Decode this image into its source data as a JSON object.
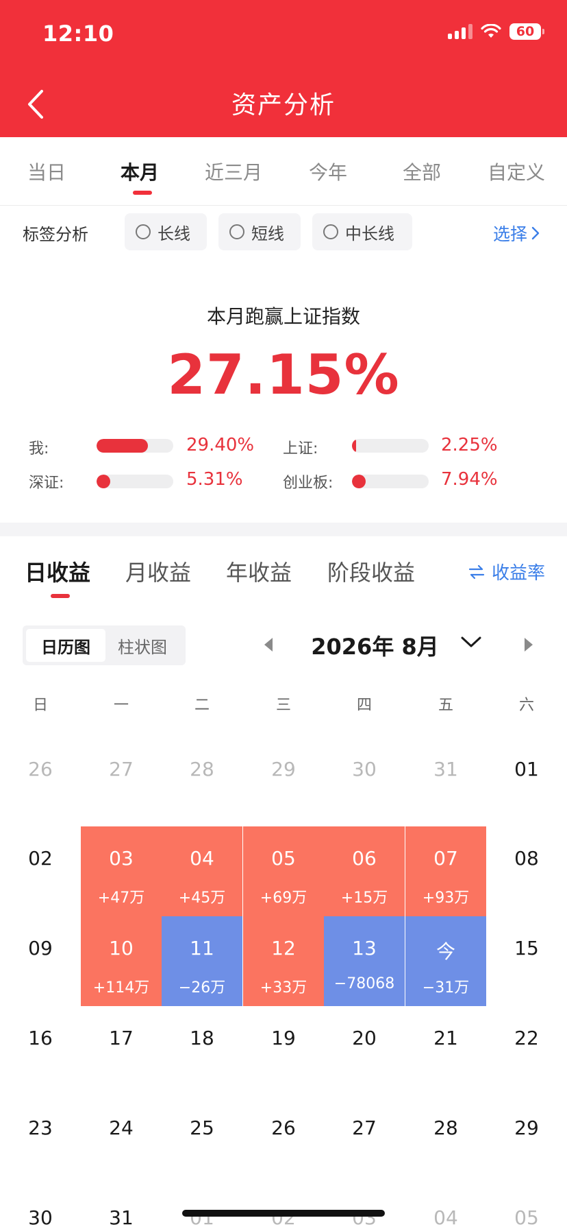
{
  "status_bar": {
    "time": "12:10",
    "battery": "60"
  },
  "header": {
    "title": "资产分析"
  },
  "period_tabs": [
    {
      "label": "当日"
    },
    {
      "label": "本月",
      "active": true
    },
    {
      "label": "近三月"
    },
    {
      "label": "今年"
    },
    {
      "label": "全部"
    },
    {
      "label": "自定义"
    }
  ],
  "tag_analysis": {
    "title": "标签分析",
    "options": [
      "长线",
      "短线",
      "中长线"
    ],
    "select_label": "选择"
  },
  "summary": {
    "title": "本月跑赢上证指数",
    "value": "27.15%",
    "comparisons": [
      {
        "label": "我:",
        "value": "29.40%",
        "level": 0.67
      },
      {
        "label": "上证:",
        "value": "2.25%",
        "level": 0.05
      },
      {
        "label": "深证:",
        "value": "5.31%",
        "level": 0.12
      },
      {
        "label": "创业板:",
        "value": "7.94%",
        "level": 0.18
      }
    ]
  },
  "income_tabs": [
    {
      "label": "日收益",
      "active": true
    },
    {
      "label": "月收益"
    },
    {
      "label": "年收益"
    },
    {
      "label": "阶段收益"
    }
  ],
  "rate_link": "收益率",
  "calendar": {
    "view_toggle": [
      "日历图",
      "柱状图"
    ],
    "month_label": "2026年 8月",
    "weekdays": [
      "日",
      "一",
      "二",
      "三",
      "四",
      "五",
      "六"
    ],
    "weeks": [
      [
        {
          "day": "26",
          "muted": true
        },
        {
          "day": "27",
          "muted": true
        },
        {
          "day": "28",
          "muted": true
        },
        {
          "day": "29",
          "muted": true
        },
        {
          "day": "30",
          "muted": true
        },
        {
          "day": "31",
          "muted": true
        },
        {
          "day": "01"
        }
      ],
      [
        {
          "day": "02"
        },
        {
          "day": "03",
          "amount": "+47万",
          "trend": "gain"
        },
        {
          "day": "04",
          "amount": "+45万",
          "trend": "gain"
        },
        {
          "day": "05",
          "amount": "+69万",
          "trend": "gain"
        },
        {
          "day": "06",
          "amount": "+15万",
          "trend": "gain"
        },
        {
          "day": "07",
          "amount": "+93万",
          "trend": "gain"
        },
        {
          "day": "08"
        }
      ],
      [
        {
          "day": "09"
        },
        {
          "day": "10",
          "amount": "+114万",
          "trend": "gain"
        },
        {
          "day": "11",
          "amount": "−26万",
          "trend": "loss"
        },
        {
          "day": "12",
          "amount": "+33万",
          "trend": "gain"
        },
        {
          "day": "13",
          "amount": "−78068",
          "trend": "loss"
        },
        {
          "day": "今",
          "amount": "−31万",
          "trend": "loss"
        },
        {
          "day": "15"
        }
      ],
      [
        {
          "day": "16"
        },
        {
          "day": "17"
        },
        {
          "day": "18"
        },
        {
          "day": "19"
        },
        {
          "day": "20"
        },
        {
          "day": "21"
        },
        {
          "day": "22"
        }
      ],
      [
        {
          "day": "23"
        },
        {
          "day": "24"
        },
        {
          "day": "25"
        },
        {
          "day": "26"
        },
        {
          "day": "27"
        },
        {
          "day": "28"
        },
        {
          "day": "29"
        }
      ],
      [
        {
          "day": "30"
        },
        {
          "day": "31"
        },
        {
          "day": "01",
          "muted": true
        },
        {
          "day": "02",
          "muted": true
        },
        {
          "day": "03",
          "muted": true
        },
        {
          "day": "04",
          "muted": true
        },
        {
          "day": "05",
          "muted": true
        }
      ]
    ]
  },
  "colors": {
    "brand_red": "#F1303A",
    "gain": "#FB7460",
    "loss": "#6E8FE6",
    "link_blue": "#3a7ee8"
  }
}
